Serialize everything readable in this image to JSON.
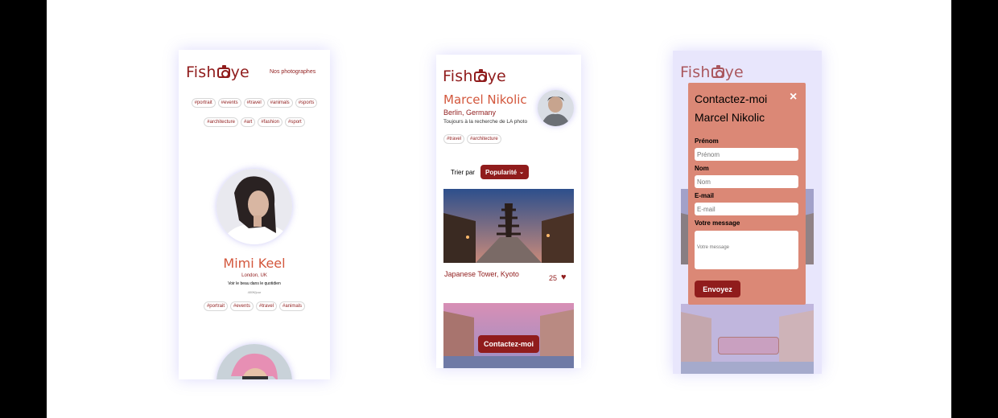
{
  "colors": {
    "brand": "#901C1C",
    "accent": "#D3573C",
    "modal_bg": "#DB8876",
    "overlay": "#E8E6FC"
  },
  "logo": {
    "left": "Fish",
    "right": "ye"
  },
  "home": {
    "nav_label": "Nos photographes",
    "tags_row1": [
      "#portrait",
      "#events",
      "#travel",
      "#animals",
      "#sports"
    ],
    "tags_row2": [
      "#architecture",
      "#art",
      "#fashion",
      "#sport"
    ],
    "card": {
      "name": "Mimi Keel",
      "location": "London, UK",
      "tagline": "Voir le beau dans le quotidien",
      "price": "400€/jour",
      "tags": [
        "#portrait",
        "#events",
        "#travel",
        "#animals"
      ]
    }
  },
  "profile": {
    "name": "Marcel Nikolic",
    "location": "Berlin, Germany",
    "tagline": "Toujours à la recherche de LA photo",
    "tags": [
      "#travel",
      "#architecture"
    ],
    "sort_label": "Trier par",
    "sort_value": "Popularité",
    "media": [
      {
        "title": "Japanese Tower, Kyoto",
        "likes": "25"
      }
    ],
    "contact_button": "Contactez-moi"
  },
  "modal": {
    "title_line1": "Contactez-moi",
    "title_line2": "Marcel Nikolic",
    "close_icon": "×",
    "first_name_label": "Prénom",
    "first_name_placeholder": "Prénom",
    "last_name_label": "Nom",
    "last_name_placeholder": "Nom",
    "email_label": "E-mail",
    "email_placeholder": "E-mail",
    "message_label": "Votre message",
    "message_placeholder": "Votre message",
    "submit": "Envoyez"
  }
}
